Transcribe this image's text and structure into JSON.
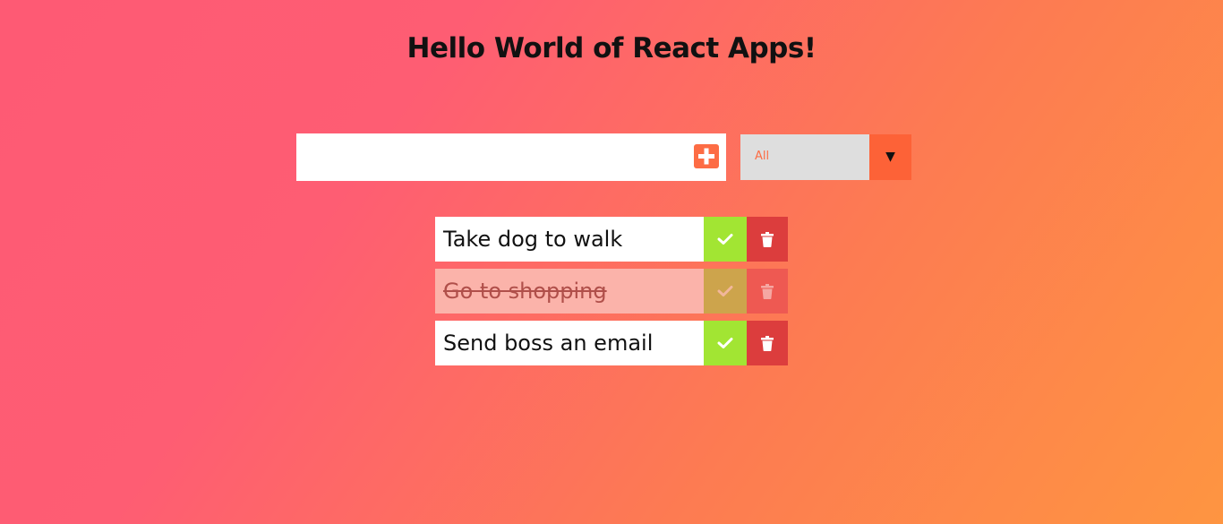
{
  "header": {
    "title": "Hello World of React Apps!"
  },
  "form": {
    "input_value": "",
    "input_placeholder": "",
    "add_icon": "plus-square-icon",
    "filter": {
      "selected": "All",
      "arrow_glyph": "▼"
    }
  },
  "todos": [
    {
      "text": "Take dog to walk",
      "completed": false
    },
    {
      "text": "Go to shopping",
      "completed": true
    },
    {
      "text": "Send boss an email",
      "completed": false
    }
  ],
  "icons": {
    "complete": "check-icon",
    "delete": "trash-icon"
  },
  "colors": {
    "accent": "#fd6c44",
    "complete": "#a2e533",
    "delete": "#dc3d3d",
    "gradient_start": "#fe5a74",
    "gradient_end": "#fe9541"
  }
}
